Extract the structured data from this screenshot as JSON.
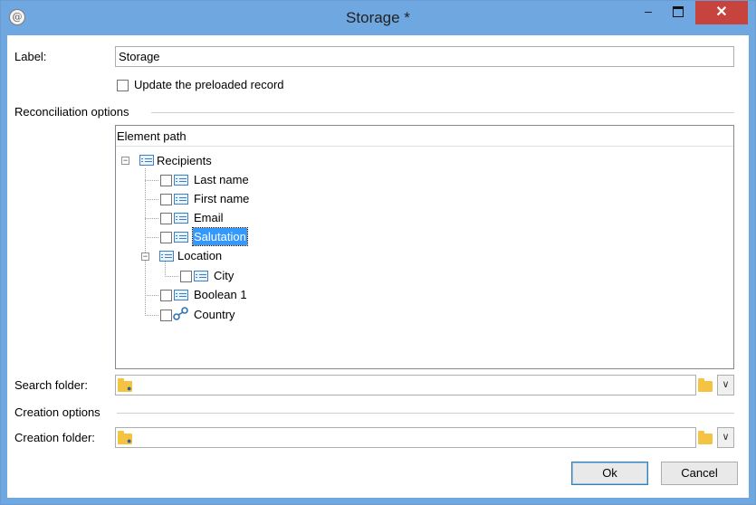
{
  "window": {
    "title": "Storage *",
    "close_glyph": "✕",
    "minimize_glyph": "–"
  },
  "fields": {
    "label_caption": "Label:",
    "label_value": "Storage",
    "update_preloaded_label": "Update the preloaded record",
    "search_folder_caption": "Search folder:",
    "search_folder_value": "",
    "creation_folder_caption": "Creation folder:",
    "creation_folder_value": ""
  },
  "sections": {
    "reconciliation": "Reconciliation options",
    "creation": "Creation options"
  },
  "tree": {
    "header": "Element path",
    "root": {
      "label": "Recipients",
      "expanded": true
    },
    "items": [
      {
        "label": "Last name",
        "icon": "field-list-icon"
      },
      {
        "label": "First name",
        "icon": "field-list-icon"
      },
      {
        "label": "Email",
        "icon": "field-list-icon"
      },
      {
        "label": "Salutation",
        "icon": "field-list-icon",
        "selected": true
      },
      {
        "label": "Location",
        "icon": "element-list-icon",
        "expanded": true
      },
      {
        "label": "City",
        "icon": "field-list-icon"
      },
      {
        "label": "Boolean 1",
        "icon": "field-list-icon"
      },
      {
        "label": "Country",
        "icon": "link-icon"
      }
    ]
  },
  "buttons": {
    "ok": "Ok",
    "cancel": "Cancel"
  },
  "colors": {
    "titlebar": "#6fa7e0",
    "close": "#c7433d",
    "selection": "#3399ff",
    "folder": "#f5c342"
  }
}
